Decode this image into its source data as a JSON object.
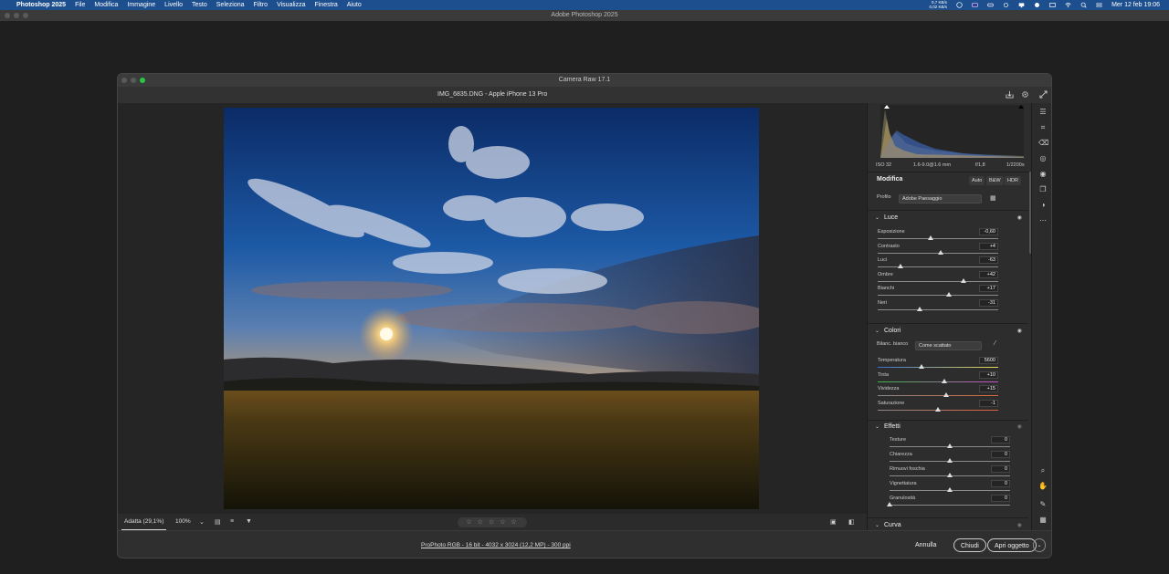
{
  "menubar": {
    "app": "Photoshop 2025",
    "items": [
      "File",
      "Modifica",
      "Immagine",
      "Livello",
      "Testo",
      "Seleziona",
      "Filtro",
      "Visualizza",
      "Finestra",
      "Aiuto"
    ],
    "net_up": "0,7 KB/s",
    "net_down": "0,02 KB/s",
    "datetime": "Mer 12 feb  19:06"
  },
  "ps_window": {
    "title": "Adobe Photoshop 2025"
  },
  "camera_raw": {
    "title": "Camera Raw 17.1",
    "file_label": "IMG_6835.DNG  -  Apple iPhone 13 Pro"
  },
  "viewbar": {
    "fit_label": "Adatta (29,1%)",
    "zoom_label": "100%",
    "stars": "☆ ☆ ☆ ☆ ☆"
  },
  "exif": {
    "iso": "ISO 32",
    "lens": "1.6-9.0@1.6 mm",
    "aperture": "f/1,8",
    "shutter": "1/2200s"
  },
  "panel": {
    "modifica_label": "Modifica",
    "auto_label": "Auto",
    "bw_label": "B&W",
    "hdr_label": "HDR",
    "profile_label": "Profilo",
    "profile_value": "Adobe Paesaggio",
    "luce": {
      "title": "Luce",
      "sliders": [
        {
          "label": "Esposizione",
          "value": "-0,60",
          "pos": 0.44
        },
        {
          "label": "Contrasto",
          "value": "+4",
          "pos": 0.52
        },
        {
          "label": "Luci",
          "value": "-63",
          "pos": 0.19
        },
        {
          "label": "Ombre",
          "value": "+42",
          "pos": 0.71
        },
        {
          "label": "Bianchi",
          "value": "+17",
          "pos": 0.59
        },
        {
          "label": "Neri",
          "value": "-31",
          "pos": 0.35
        }
      ]
    },
    "colori": {
      "title": "Colori",
      "wb_label": "Bilanc. bianco",
      "wb_value": "Come scattato",
      "sliders": [
        {
          "label": "Temperatura",
          "value": "5600",
          "pos": 0.36
        },
        {
          "label": "Tinta",
          "value": "+10",
          "pos": 0.55
        },
        {
          "label": "Vividezza",
          "value": "+15",
          "pos": 0.57
        },
        {
          "label": "Saturazione",
          "value": "-1",
          "pos": 0.5
        }
      ]
    },
    "effetti": {
      "title": "Effetti",
      "sliders": [
        {
          "label": "Texture",
          "value": "0",
          "pos": 0.5
        },
        {
          "label": "Chiarezza",
          "value": "0",
          "pos": 0.5
        },
        {
          "label": "Rimuovi foschia",
          "value": "0",
          "pos": 0.5
        },
        {
          "label": "Vignettatura",
          "value": "0",
          "pos": 0.5
        },
        {
          "label": "Granulosità",
          "value": "0",
          "pos": 0.0
        }
      ]
    },
    "curva": {
      "title": "Curva"
    }
  },
  "bottom": {
    "info": "ProPhoto RGB - 16 bit - 4032 x 3024 (12,2 MP) - 300 ppi",
    "cancel": "Annulla",
    "close": "Chiudi",
    "open": "Apri oggetto"
  }
}
